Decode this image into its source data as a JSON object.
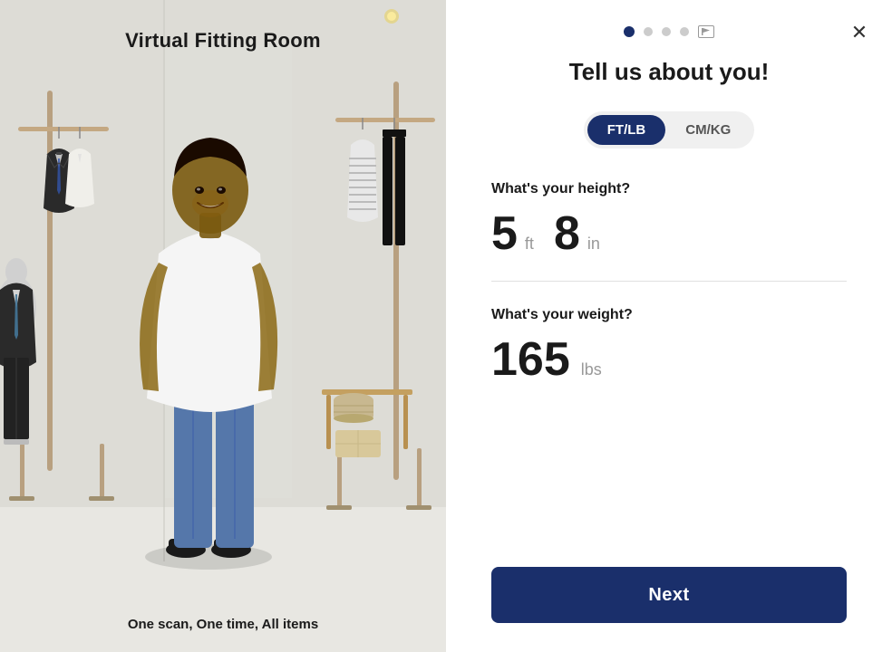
{
  "left": {
    "title": "Virtual Fitting Room",
    "subtitle": "One scan, One time, All items"
  },
  "right": {
    "title": "Tell us about you!",
    "close_label": "×",
    "units": {
      "ft_lb": "FT/LB",
      "cm_kg": "CM/KG",
      "active": "ft_lb"
    },
    "height_label": "What's your height?",
    "height_feet": "5",
    "height_feet_unit": "ft",
    "height_inches": "8",
    "height_inches_unit": "in",
    "weight_label": "What's your weight?",
    "weight_value": "165",
    "weight_unit": "lbs",
    "next_label": "Next"
  },
  "progress": {
    "total": 5,
    "active": 0,
    "dots": [
      {
        "active": true
      },
      {
        "active": false
      },
      {
        "active": false
      },
      {
        "active": false
      },
      {
        "flag": true
      }
    ]
  }
}
